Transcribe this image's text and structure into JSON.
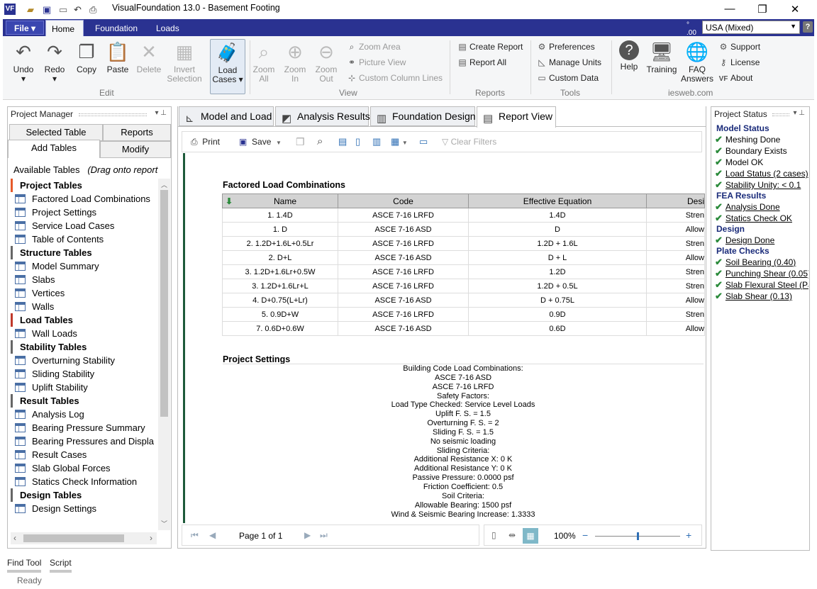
{
  "window": {
    "title": "VisualFoundation 13.0 - Basement Footing",
    "minimize": "—",
    "maximize": "❐",
    "close": "✕"
  },
  "ribbon_tabs": {
    "file": "File",
    "home": "Home",
    "foundation": "Foundation",
    "loads": "Loads"
  },
  "units": {
    "icon_label": "°\n.00",
    "value": "USA (Mixed)"
  },
  "edit_group": {
    "undo": "Undo",
    "redo": "Redo",
    "copy": "Copy",
    "paste": "Paste",
    "delete": "Delete",
    "invert_l1": "Invert",
    "invert_l2": "Selection",
    "load_l1": "Load",
    "load_l2": "Cases",
    "label": "Edit"
  },
  "view_group": {
    "zoom_all_l1": "Zoom",
    "zoom_all_l2": "All",
    "zoom_in_l1": "Zoom",
    "zoom_in_l2": "In",
    "zoom_out_l1": "Zoom",
    "zoom_out_l2": "Out",
    "zoom_area": "Zoom Area",
    "picture_view": "Picture View",
    "custom_column_lines": "Custom Column Lines",
    "label": "View"
  },
  "reports_group": {
    "create_report": "Create Report",
    "report_all": "Report All",
    "label": "Reports"
  },
  "tools_group": {
    "preferences": "Preferences",
    "manage_units": "Manage Units",
    "custom_data": "Custom Data",
    "label": "Tools"
  },
  "help_group": {
    "help": "Help",
    "training": "Training",
    "faq_l1": "FAQ",
    "faq_l2": "Answers",
    "support": "Support",
    "license": "License",
    "about": "About",
    "label": "iesweb.com"
  },
  "project_manager": {
    "title": "Project Manager",
    "tabs": {
      "selected_table": "Selected Table",
      "reports": "Reports",
      "add_tables": "Add Tables",
      "modify": "Modify"
    },
    "available_label": "Available Tables",
    "drag_hint": "(Drag onto report",
    "categories": [
      {
        "name": "Project Tables",
        "items": [
          "Factored Load Combinations",
          "Project Settings",
          "Service Load Cases",
          "Table of Contents"
        ]
      },
      {
        "name": "Structure Tables",
        "items": [
          "Model Summary",
          "Slabs",
          "Vertices",
          "Walls"
        ]
      },
      {
        "name": "Load Tables",
        "items": [
          "Wall Loads"
        ]
      },
      {
        "name": "Stability Tables",
        "items": [
          "Overturning Stability",
          "Sliding Stability",
          "Uplift Stability"
        ]
      },
      {
        "name": "Result Tables",
        "items": [
          "Analysis Log",
          "Bearing Pressure Summary",
          "Bearing Pressures and Displa",
          "Result Cases",
          "Slab Global Forces",
          "Statics Check Information"
        ]
      },
      {
        "name": "Design Tables",
        "items": [
          "Design Settings"
        ]
      }
    ]
  },
  "doc_tabs": {
    "model_load": "Model and Load",
    "analysis_results": "Analysis Results",
    "foundation_design": "Foundation Design",
    "report_view": "Report View"
  },
  "report_toolbar": {
    "print": "Print",
    "save": "Save",
    "clear_filters": "Clear Filters"
  },
  "report": {
    "table_title": "Factored Load Combinations",
    "columns": [
      "Name",
      "Code",
      "Effective Equation",
      "Desi"
    ],
    "rows": [
      [
        "1. 1.4D",
        "ASCE 7-16 LRFD",
        "1.4D",
        "Stren"
      ],
      [
        "1. D",
        "ASCE 7-16 ASD",
        "D",
        "Allow"
      ],
      [
        "2. 1.2D+1.6L+0.5Lr",
        "ASCE 7-16 LRFD",
        "1.2D + 1.6L",
        "Stren"
      ],
      [
        "2. D+L",
        "ASCE 7-16 ASD",
        "D + L",
        "Allow"
      ],
      [
        "3. 1.2D+1.6Lr+0.5W",
        "ASCE 7-16 LRFD",
        "1.2D",
        "Stren"
      ],
      [
        "3. 1.2D+1.6Lr+L",
        "ASCE 7-16 LRFD",
        "1.2D + 0.5L",
        "Stren"
      ],
      [
        "4. D+0.75(L+Lr)",
        "ASCE 7-16 ASD",
        "D + 0.75L",
        "Allow"
      ],
      [
        "5. 0.9D+W",
        "ASCE 7-16 LRFD",
        "0.9D",
        "Stren"
      ],
      [
        "7. 0.6D+0.6W",
        "ASCE 7-16 ASD",
        "0.6D",
        "Allow"
      ]
    ],
    "settings_title": "Project Settings",
    "settings_lines": [
      "Building Code Load Combinations:",
      "ASCE 7-16 ASD",
      "ASCE 7-16 LRFD",
      "Safety Factors:",
      "Load Type Checked: Service Level Loads",
      "Uplift F. S. = 1.5",
      "Overturning F. S. = 2",
      "Sliding F. S. = 1.5",
      "No seismic loading",
      "Sliding Criteria:",
      "Additional Resistance X: 0 K",
      "Additional Resistance Y: 0 K",
      "Passive Pressure: 0.0000 psf",
      "Friction Coefficient: 0.5",
      "Soil Criteria:",
      "Allowable Bearing: 1500 psf",
      "Wind & Seismic Bearing Increase: 1.3333"
    ]
  },
  "pager": {
    "page_label": "Page 1 of 1",
    "zoom": "100%",
    "zoom_level": 0.5
  },
  "project_status": {
    "title": "Project Status",
    "model_status": "Model Status",
    "meshing": "Meshing Done",
    "boundary": "Boundary Exists",
    "model_ok": "Model OK",
    "load_status": "Load Status (2 cases)",
    "stability": "Stability Unity: < 0.1",
    "fea_results": "FEA Results",
    "analysis_done": "Analysis Done",
    "statics": "Statics Check OK",
    "design": "Design",
    "design_done": "Design Done",
    "plate_checks": "Plate Checks",
    "soil_bearing": "Soil Bearing (0.40)",
    "punching_shear": "Punching Shear (0.05)",
    "slab_flexural": "Slab Flexural Steel (Pa",
    "slab_shear": "Slab Shear (0.13)"
  },
  "bottom": {
    "find_tool": "Find Tool",
    "script": "Script",
    "status": "Ready"
  }
}
